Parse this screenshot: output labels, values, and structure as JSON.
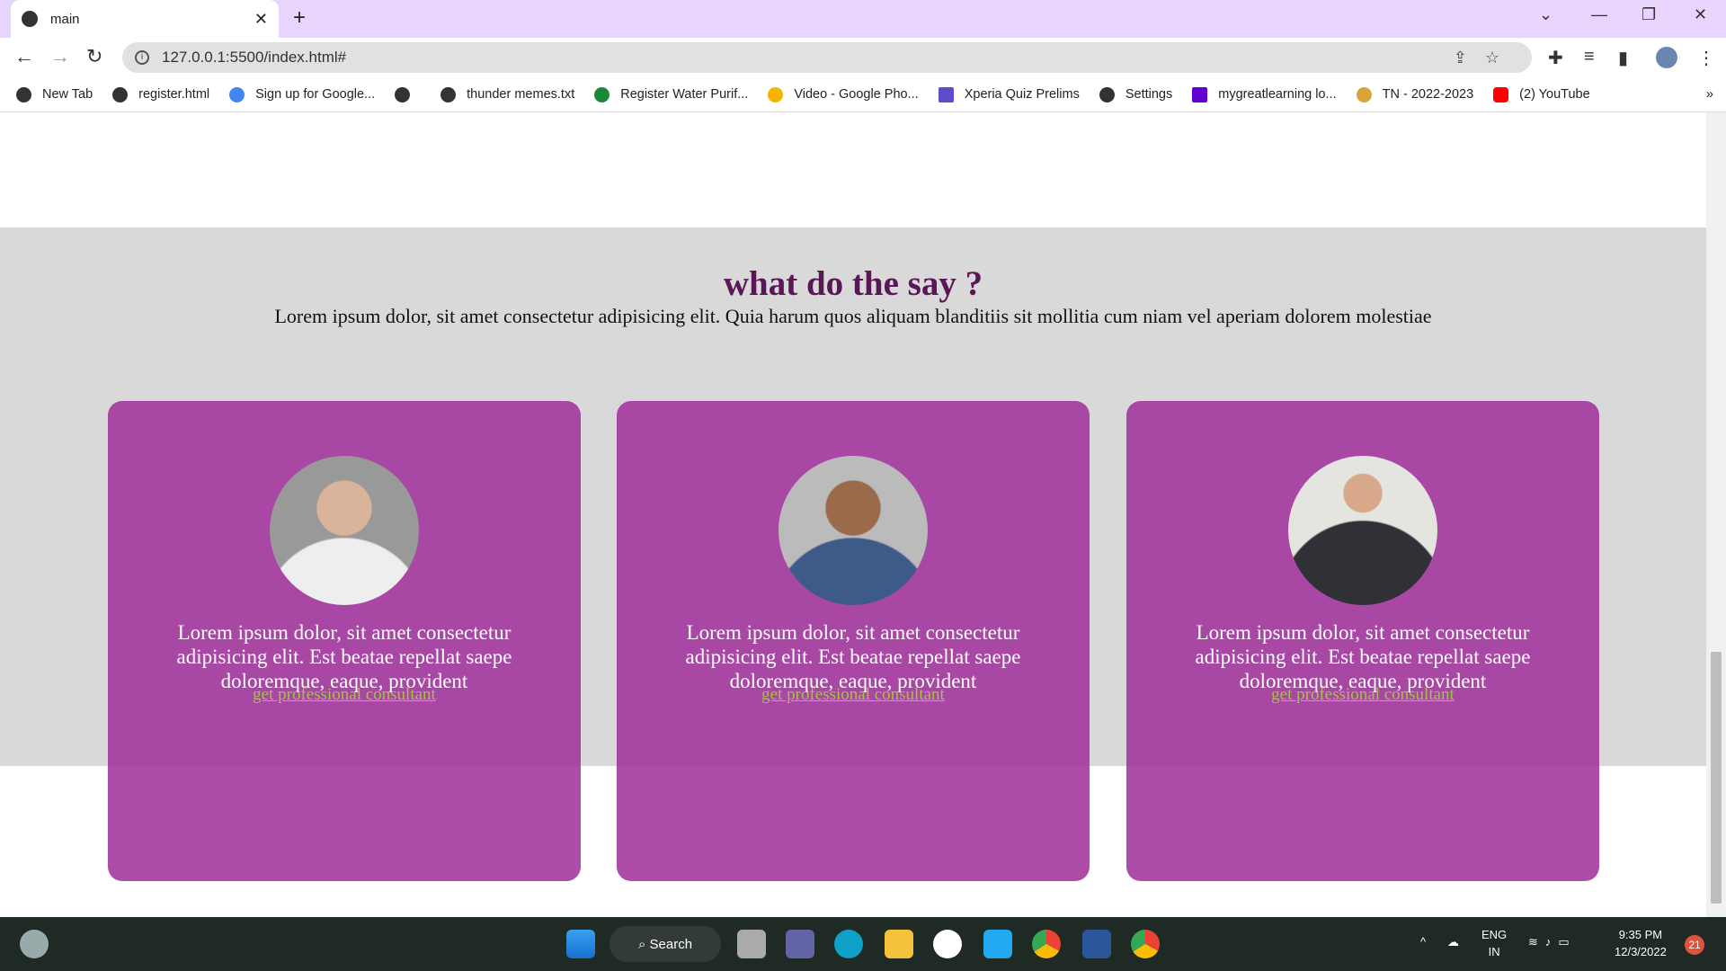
{
  "browser": {
    "tab_title": "main",
    "url": "127.0.0.1:5500/index.html#",
    "bookmarks": [
      "New Tab",
      "register.html",
      "Sign up for Google...",
      "",
      "thunder memes.txt",
      "Register Water Purif...",
      "Video - Google Pho...",
      "Xperia Quiz Prelims",
      "Settings",
      "mygreatlearning lo...",
      "TN - 2022-2023",
      "(2) YouTube"
    ],
    "more": "»"
  },
  "section": {
    "title": "what do the say ?",
    "subtitle": "Lorem ipsum dolor, sit amet consectetur adipisicing elit. Quia harum quos aliquam blanditiis sit mollitia cum niam vel aperiam dolorem molestiae"
  },
  "cards": [
    {
      "text": "Lorem ipsum dolor, sit amet consectetur adipisicing elit. Est beatae repellat saepe doloremque, eaque, provident",
      "link": "get professional consultant"
    },
    {
      "text": "Lorem ipsum dolor, sit amet consectetur adipisicing elit. Est beatae repellat saepe doloremque, eaque, provident",
      "link": "get professional consultant"
    },
    {
      "text": "Lorem ipsum dolor, sit amet consectetur adipisicing elit. Est beatae repellat saepe doloremque, eaque, provident",
      "link": "get professional consultant"
    }
  ],
  "taskbar": {
    "search": "Search",
    "lang1": "ENG",
    "lang2": "IN",
    "time": "9:35 PM",
    "date": "12/3/2022",
    "badge": "21"
  },
  "colors": {
    "title": "#5a1758",
    "card": "#a845a3",
    "link": "#a3c43e",
    "gray": "#d9d9d9"
  }
}
